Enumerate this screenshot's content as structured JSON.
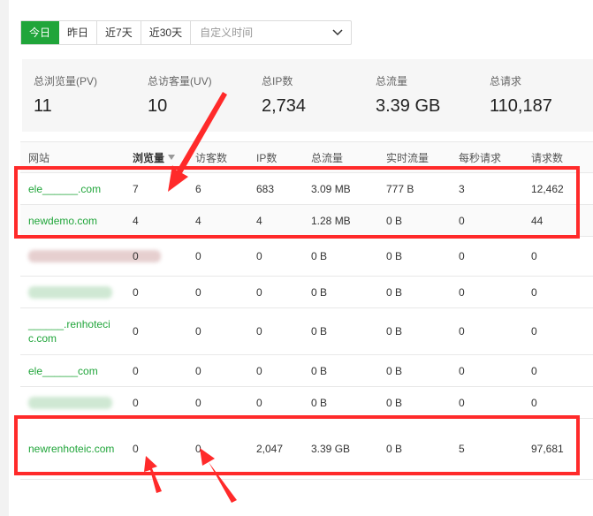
{
  "filters": {
    "buttons": [
      "今日",
      "昨日",
      "近7天",
      "近30天"
    ],
    "active_index": 0,
    "custom_placeholder": "自定义时间"
  },
  "summary": [
    {
      "label": "总浏览量(PV)",
      "value": "11"
    },
    {
      "label": "总访客量(UV)",
      "value": "10"
    },
    {
      "label": "总IP数",
      "value": "2,734"
    },
    {
      "label": "总流量",
      "value": "3.39 GB"
    },
    {
      "label": "总请求",
      "value": "110,187"
    }
  ],
  "table": {
    "headers": [
      "网站",
      "浏览量",
      "访客数",
      "IP数",
      "总流量",
      "实时流量",
      "每秒请求",
      "请求数"
    ],
    "rows": [
      {
        "site": "ele______.com",
        "pv": "7",
        "uv": "6",
        "ip": "683",
        "traffic": "3.09 MB",
        "realtime": "777 B",
        "qps": "3",
        "requests": "12,462"
      },
      {
        "site": "newdemo.com",
        "pv": "4",
        "uv": "4",
        "ip": "4",
        "traffic": "1.28 MB",
        "realtime": "0 B",
        "qps": "0",
        "requests": "44"
      },
      {
        "site": "",
        "pv": "0",
        "uv": "0",
        "ip": "0",
        "traffic": "0 B",
        "realtime": "0 B",
        "qps": "0",
        "requests": "0"
      },
      {
        "site": "",
        "pv": "0",
        "uv": "0",
        "ip": "0",
        "traffic": "0 B",
        "realtime": "0 B",
        "qps": "0",
        "requests": "0"
      },
      {
        "site": "______.renhotecic.com",
        "pv": "0",
        "uv": "0",
        "ip": "0",
        "traffic": "0 B",
        "realtime": "0 B",
        "qps": "0",
        "requests": "0"
      },
      {
        "site": "ele______com",
        "pv": "0",
        "uv": "0",
        "ip": "0",
        "traffic": "0 B",
        "realtime": "0 B",
        "qps": "0",
        "requests": "0"
      },
      {
        "site": "",
        "pv": "0",
        "uv": "0",
        "ip": "0",
        "traffic": "0 B",
        "realtime": "0 B",
        "qps": "0",
        "requests": "0"
      },
      {
        "site": "newrenhoteic.com",
        "pv": "0",
        "uv": "0",
        "ip": "2,047",
        "traffic": "3.39 GB",
        "realtime": "0 B",
        "qps": "5",
        "requests": "97,681"
      }
    ]
  },
  "colors": {
    "accent": "#20a53a",
    "annotation": "#ff2a2a"
  },
  "icons": {
    "dropdown": "chevron-down-icon",
    "sort": "sort-desc-icon"
  }
}
